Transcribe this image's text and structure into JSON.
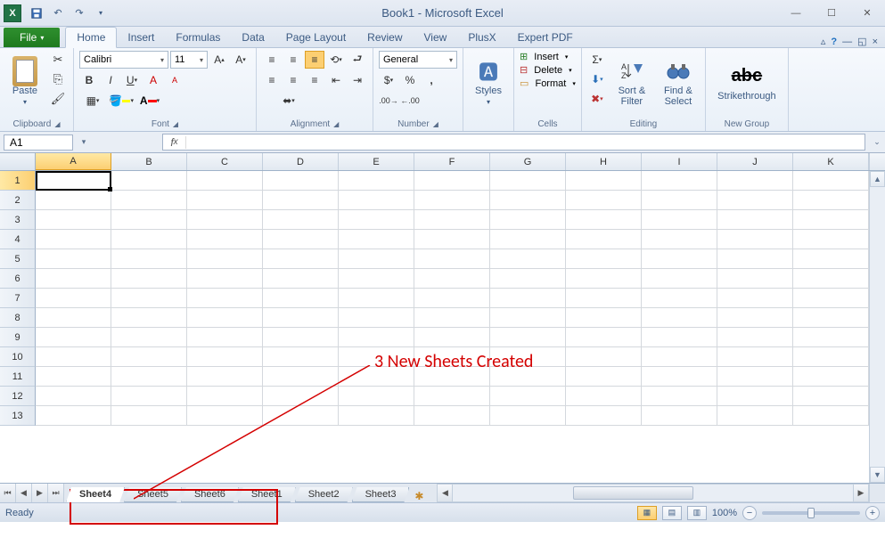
{
  "title": "Book1 - Microsoft Excel",
  "tabs": {
    "file": "File",
    "list": [
      "Home",
      "Insert",
      "Formulas",
      "Data",
      "Page Layout",
      "Review",
      "View",
      "PlusX",
      "Expert PDF"
    ],
    "active": "Home"
  },
  "ribbon": {
    "clipboard": {
      "label": "Clipboard",
      "paste": "Paste"
    },
    "font": {
      "label": "Font",
      "name": "Calibri",
      "size": "11"
    },
    "alignment": {
      "label": "Alignment"
    },
    "number": {
      "label": "Number",
      "format": "General"
    },
    "styles": {
      "label": "Styles",
      "btn": "Styles"
    },
    "cells": {
      "label": "Cells",
      "insert": "Insert",
      "delete": "Delete",
      "format": "Format"
    },
    "editing": {
      "label": "Editing",
      "sort": "Sort &\nFilter",
      "find": "Find &\nSelect"
    },
    "newgroup": {
      "label": "New Group",
      "strike": "Strikethrough"
    }
  },
  "namebox": "A1",
  "columns": [
    "A",
    "B",
    "C",
    "D",
    "E",
    "F",
    "G",
    "H",
    "I",
    "J",
    "K"
  ],
  "rows": [
    "1",
    "2",
    "3",
    "4",
    "5",
    "6",
    "7",
    "8",
    "9",
    "10",
    "11",
    "12",
    "13"
  ],
  "sheets": [
    "Sheet4",
    "Sheet5",
    "Sheet6",
    "Sheet1",
    "Sheet2",
    "Sheet3"
  ],
  "active_sheet": "Sheet4",
  "status": {
    "ready": "Ready",
    "zoom": "100%"
  },
  "annotation": "3 New Sheets Created"
}
